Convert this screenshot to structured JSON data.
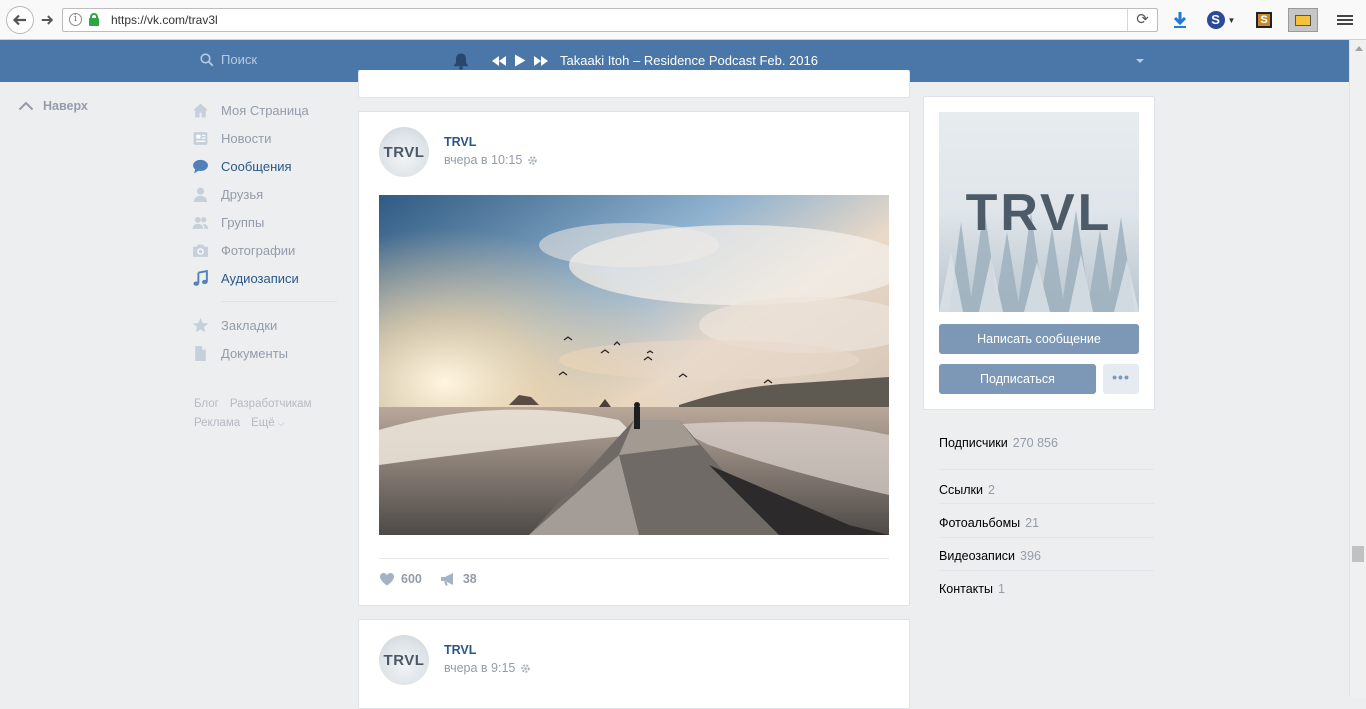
{
  "browser": {
    "url": "https://vk.com/trav3l",
    "reload_icon": "reload-icon",
    "info_icon": "info-icon",
    "lock_icon": "lock-icon"
  },
  "header": {
    "search_placeholder": "Поиск",
    "track_title": "Takaaki Itoh – Residence Podcast Feb. 2016",
    "colors": {
      "header_bg": "#4a76a8",
      "link": "#2a5885",
      "muted": "#939caa",
      "button": "#7d98b6"
    }
  },
  "go_top": {
    "label": "Наверх"
  },
  "left_menu": {
    "items": [
      {
        "label": "Моя Страница",
        "icon": "home-icon",
        "active": false
      },
      {
        "label": "Новости",
        "icon": "news-icon",
        "active": false
      },
      {
        "label": "Сообщения",
        "icon": "messages-icon",
        "active": true
      },
      {
        "label": "Друзья",
        "icon": "friends-icon",
        "active": false
      },
      {
        "label": "Группы",
        "icon": "groups-icon",
        "active": false
      },
      {
        "label": "Фотографии",
        "icon": "camera-icon",
        "active": false
      },
      {
        "label": "Аудиозаписи",
        "icon": "music-icon",
        "active": true
      }
    ],
    "extra_items": [
      {
        "label": "Закладки",
        "icon": "star-icon"
      },
      {
        "label": "Документы",
        "icon": "document-icon"
      }
    ],
    "footer": {
      "blog": "Блог",
      "developers": "Разработчикам",
      "ads": "Реклама",
      "more": "Ещё"
    }
  },
  "posts": [
    {
      "author": "TRVL",
      "date": "вчера в 10:15",
      "likes": "600",
      "reposts": "38"
    },
    {
      "author": "TRVL",
      "date": "вчера в 9:15"
    }
  ],
  "avatar_text": "TRVL",
  "group": {
    "cover_text": "TRVL",
    "write_message": "Написать сообщение",
    "subscribe": "Подписаться",
    "more": "•••",
    "followers_label": "Подписчики",
    "followers_count": "270 856",
    "links": [
      {
        "label": "Ссылки",
        "count": "2"
      },
      {
        "label": "Фотоальбомы",
        "count": "21"
      },
      {
        "label": "Видеозаписи",
        "count": "396"
      },
      {
        "label": "Контакты",
        "count": "1"
      }
    ]
  }
}
